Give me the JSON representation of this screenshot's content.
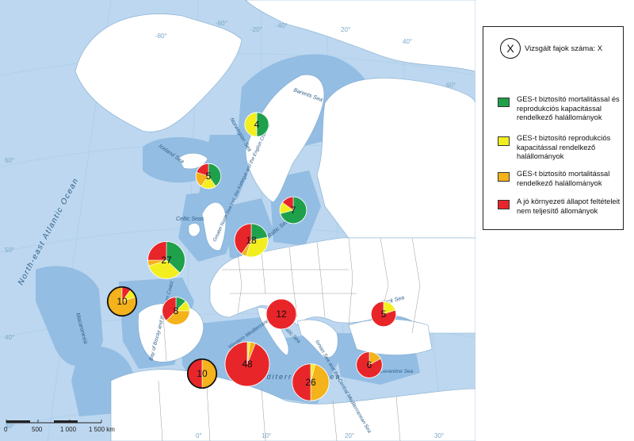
{
  "legend": {
    "key_symbol": "X",
    "key_label": "Vizsgált fajok száma: X",
    "items": [
      {
        "color": "#1fa04a",
        "label": "GES-t biztosító mortalitással és reprodukciós kapacitással rendelkező halállományok"
      },
      {
        "color": "#f2ee1f",
        "label": "GES-t biztosító reprodukciós kapacitással rendelkező halállományok"
      },
      {
        "color": "#f4b21b",
        "label": "GES-t biztosító mortalitással rendelkező halállományok"
      },
      {
        "color": "#e8262a",
        "label": "A jó környezeti állapot feltételeit nem teljesítő állományok"
      }
    ]
  },
  "colors": {
    "sea": "#bcd7ef",
    "land": "#ffffff",
    "assessment_area": "#93bde3",
    "graticule": "#a9cbe8",
    "border": "#9a9a9a"
  },
  "map_labels": {
    "north_east_atlantic": "North-east Atlantic Ocean",
    "barents": "Barents Sea",
    "norwegian": "Norwegian Sea",
    "iceland": "Iceland Sea",
    "celtic": "Celtic Seas",
    "greater_north_sea": "Greater North Sea incl. the Kattegat and the English Channel",
    "baltic": "Baltic Sea",
    "biscay": "Bay of Biscay and the Iberian Coast",
    "macaronesia": "Macaronesia",
    "western_med": "Western Mediterranean Sea",
    "adriatic": "Adriatic Sea",
    "ionian": "Ionian Sea and the Central Mediterranean Sea",
    "aegean": "Aegean-Levantine Sea",
    "black": "Black Sea",
    "mediterranean": "Mediterranean Sea"
  },
  "coordinates": {
    "lon_top": [
      "-80°",
      "-20°",
      "-60°",
      "-40°",
      "20°",
      "40°",
      "60°"
    ],
    "lat_left": [
      "60°",
      "50°",
      "40°",
      "30°"
    ],
    "lon_bottom": [
      "0°",
      "10°",
      "20°",
      "30°"
    ]
  },
  "scale_bar": {
    "ticks": [
      "0",
      "500",
      "1 000",
      "1 500 km"
    ]
  },
  "pies": [
    {
      "region": "Barents",
      "n": 4,
      "shares": {
        "green": 0.5,
        "yellow": 0.5,
        "orange": 0,
        "red": 0
      }
    },
    {
      "region": "Iceland",
      "n": 5,
      "shares": {
        "green": 0.4,
        "yellow": 0.2,
        "orange": 0.2,
        "red": 0.2
      }
    },
    {
      "region": "Baltic",
      "n": 7,
      "shares": {
        "green": 0.71,
        "yellow": 0.14,
        "orange": 0,
        "red": 0.15
      }
    },
    {
      "region": "North Sea",
      "n": 18,
      "shares": {
        "green": 0.22,
        "yellow": 0.33,
        "orange": 0.05,
        "red": 0.4
      }
    },
    {
      "region": "Celtic",
      "n": 27,
      "shares": {
        "green": 0.37,
        "yellow": 0.33,
        "orange": 0.05,
        "red": 0.25
      }
    },
    {
      "region": "Macaronesia",
      "n": 10,
      "shares": {
        "green": 0.1,
        "yellow": 0.1,
        "orange": 0.8,
        "red": 0.1
      },
      "outlined": true
    },
    {
      "region": "Biscay",
      "n": 8,
      "shares": {
        "green": 0.125,
        "yellow": 0.125,
        "orange": 0.375,
        "red": 0.375
      }
    },
    {
      "region": "Adriatic",
      "n": 12,
      "shares": {
        "green": 0,
        "yellow": 0,
        "orange": 0,
        "red": 1
      }
    },
    {
      "region": "Black Sea",
      "n": 5,
      "shares": {
        "green": 0,
        "yellow": 0.2,
        "orange": 0,
        "red": 0.8
      }
    },
    {
      "region": "Western Med",
      "n": 48,
      "shares": {
        "green": 0,
        "yellow": 0.02,
        "orange": 0.04,
        "red": 0.94
      }
    },
    {
      "region": "Western Med (Macaronesia style)",
      "n": 10,
      "shares": {
        "green": 0,
        "yellow": 0,
        "orange": 0.5,
        "red": 0.5
      },
      "outlined": true
    },
    {
      "region": "Ionian",
      "n": 26,
      "shares": {
        "green": 0,
        "yellow": 0.04,
        "orange": 0.46,
        "red": 0.5
      }
    },
    {
      "region": "Aegean",
      "n": 6,
      "shares": {
        "green": 0,
        "yellow": 0,
        "orange": 0.17,
        "red": 0.83
      }
    }
  ]
}
